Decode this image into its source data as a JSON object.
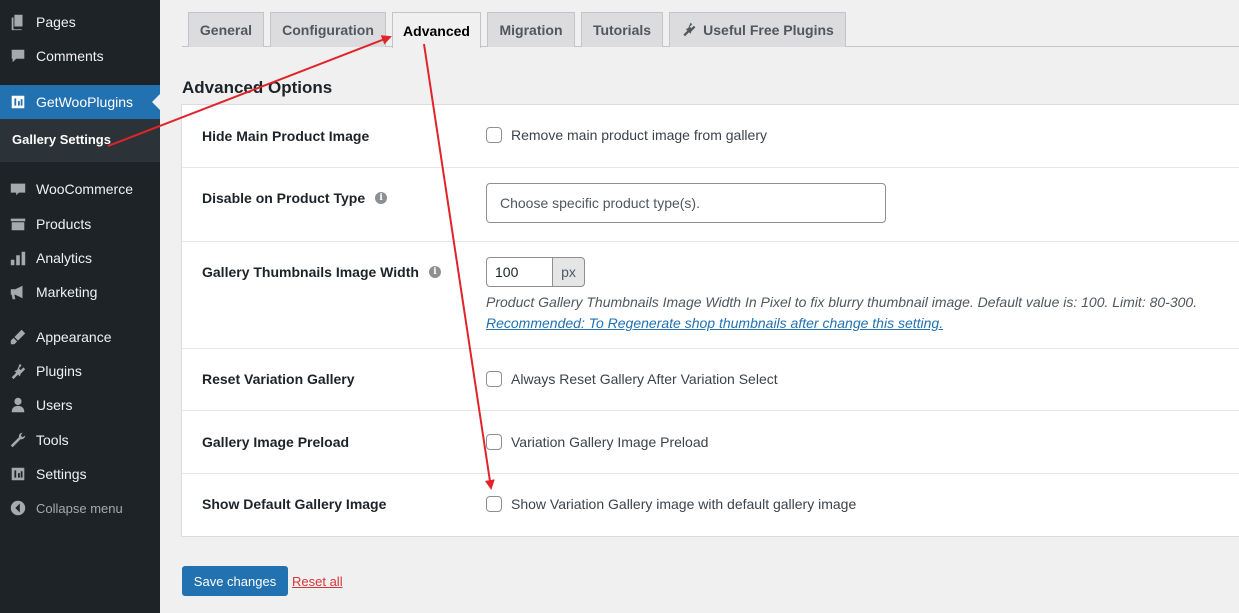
{
  "sidebar": {
    "items": [
      {
        "label": "Pages",
        "icon": "pages-icon"
      },
      {
        "label": "Comments",
        "icon": "comments-icon"
      },
      {
        "label": "GetWooPlugins",
        "icon": "getwooplugins-icon"
      },
      {
        "label": "WooCommerce",
        "icon": "woocommerce-icon"
      },
      {
        "label": "Products",
        "icon": "products-icon"
      },
      {
        "label": "Analytics",
        "icon": "analytics-icon"
      },
      {
        "label": "Marketing",
        "icon": "marketing-icon"
      },
      {
        "label": "Appearance",
        "icon": "appearance-icon"
      },
      {
        "label": "Plugins",
        "icon": "plugins-icon"
      },
      {
        "label": "Users",
        "icon": "users-icon"
      },
      {
        "label": "Tools",
        "icon": "tools-icon"
      },
      {
        "label": "Settings",
        "icon": "settings-icon"
      }
    ],
    "submenu_label": "Gallery Settings",
    "collapse_label": "Collapse menu",
    "active_color": "#2271b1"
  },
  "tabs": [
    "General",
    "Configuration",
    "Advanced",
    "Migration",
    "Tutorials",
    "Useful Free Plugins"
  ],
  "active_tab": "Advanced",
  "section_title": "Advanced Options",
  "rows": {
    "hide_main": {
      "label": "Hide Main Product Image",
      "checkbox_label": "Remove main product image from gallery"
    },
    "disable_type": {
      "label": "Disable on Product Type",
      "placeholder": "Choose specific product type(s)."
    },
    "thumb_width": {
      "label": "Gallery Thumbnails Image Width",
      "value": "100",
      "suffix": "px",
      "description": "Product Gallery Thumbnails Image Width In Pixel to fix blurry thumbnail image. Default value is: 100. Limit: 80-300.",
      "link": "Recommended: To Regenerate shop thumbnails after change this setting."
    },
    "reset_variation": {
      "label": "Reset Variation Gallery",
      "checkbox_label": "Always Reset Gallery After Variation Select"
    },
    "preload": {
      "label": "Gallery Image Preload",
      "checkbox_label": "Variation Gallery Image Preload"
    },
    "show_default": {
      "label": "Show Default Gallery Image",
      "checkbox_label": "Show Variation Gallery image with default gallery image"
    }
  },
  "buttons": {
    "save": "Save changes",
    "reset": "Reset all"
  },
  "annotation_color": "#e0242a"
}
